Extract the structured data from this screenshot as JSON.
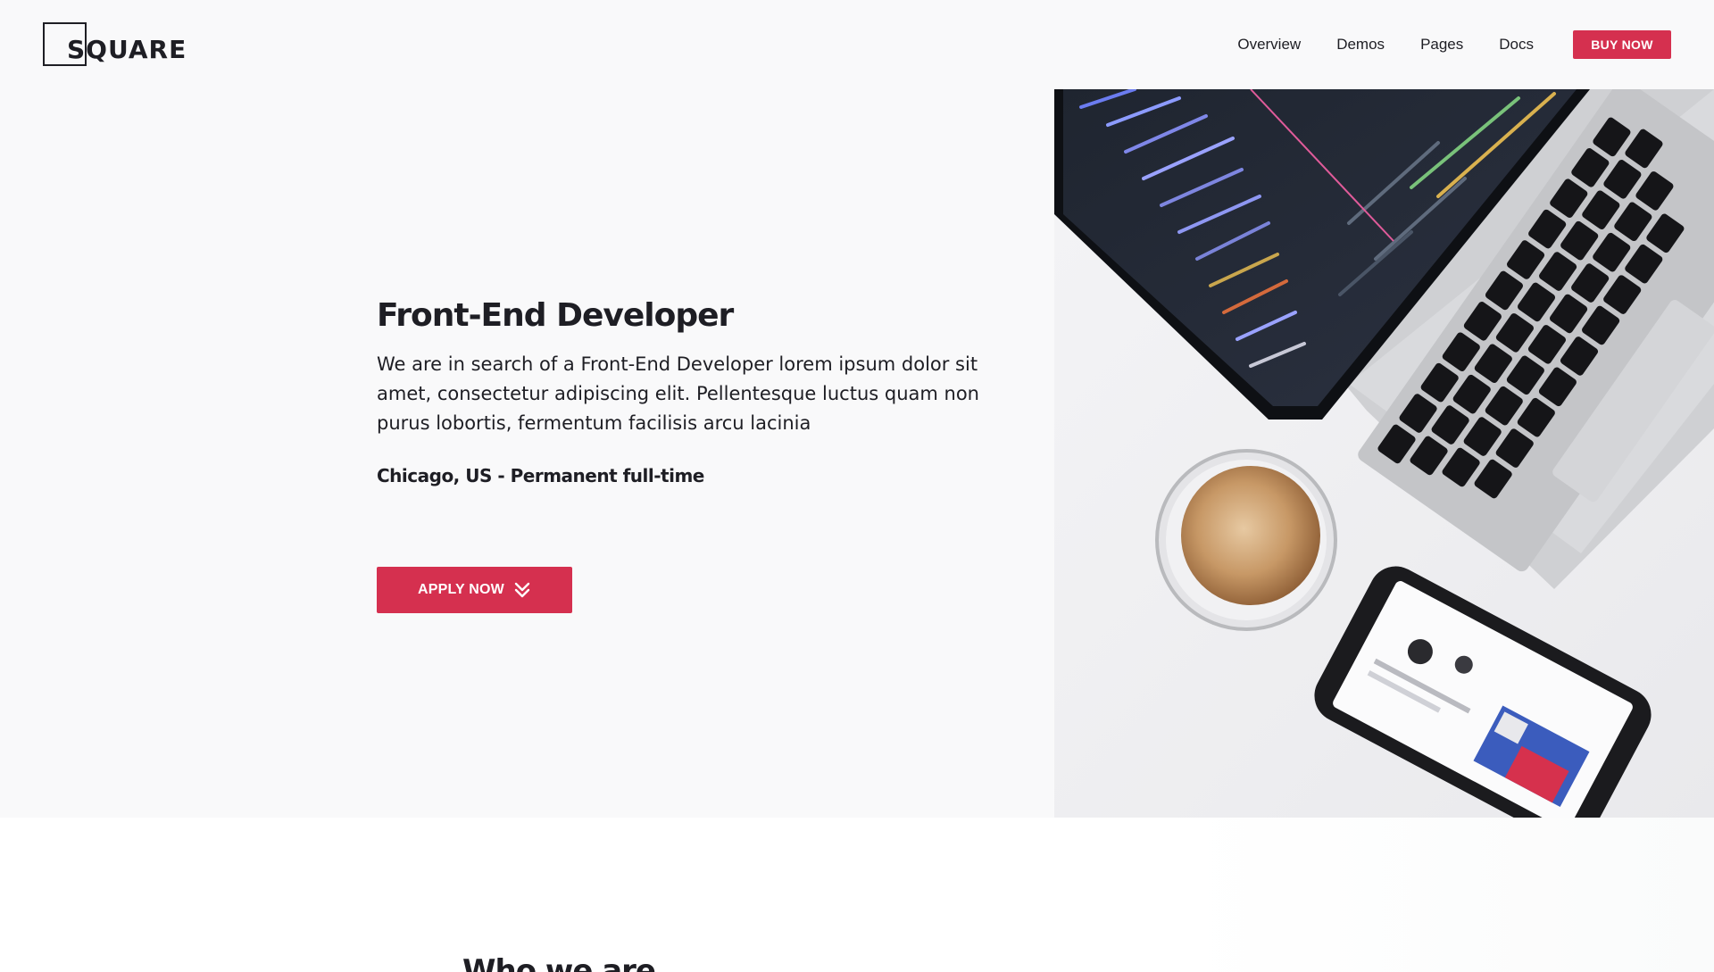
{
  "header": {
    "logo_text": "SQUARE",
    "nav": [
      {
        "label": "Overview"
      },
      {
        "label": "Demos"
      },
      {
        "label": "Pages"
      },
      {
        "label": "Docs"
      }
    ],
    "buy_label": "BUY NOW"
  },
  "hero": {
    "title": "Front-End Developer",
    "description": "We are in search of a Front-End Developer lorem ipsum dolor sit amet, consectetur adipiscing elit. Pellentesque luctus quam non purus lobortis, fermentum facilisis arcu lacinia",
    "meta": "Chicago, US - Permanent full-time",
    "apply_label": "APPLY NOW",
    "apply_icon": "double-chevron-down-icon"
  },
  "section": {
    "title": "Who we are"
  },
  "colors": {
    "accent": "#d5304f",
    "text": "#1e1e24",
    "hero_bg": "#f9f9fa"
  }
}
